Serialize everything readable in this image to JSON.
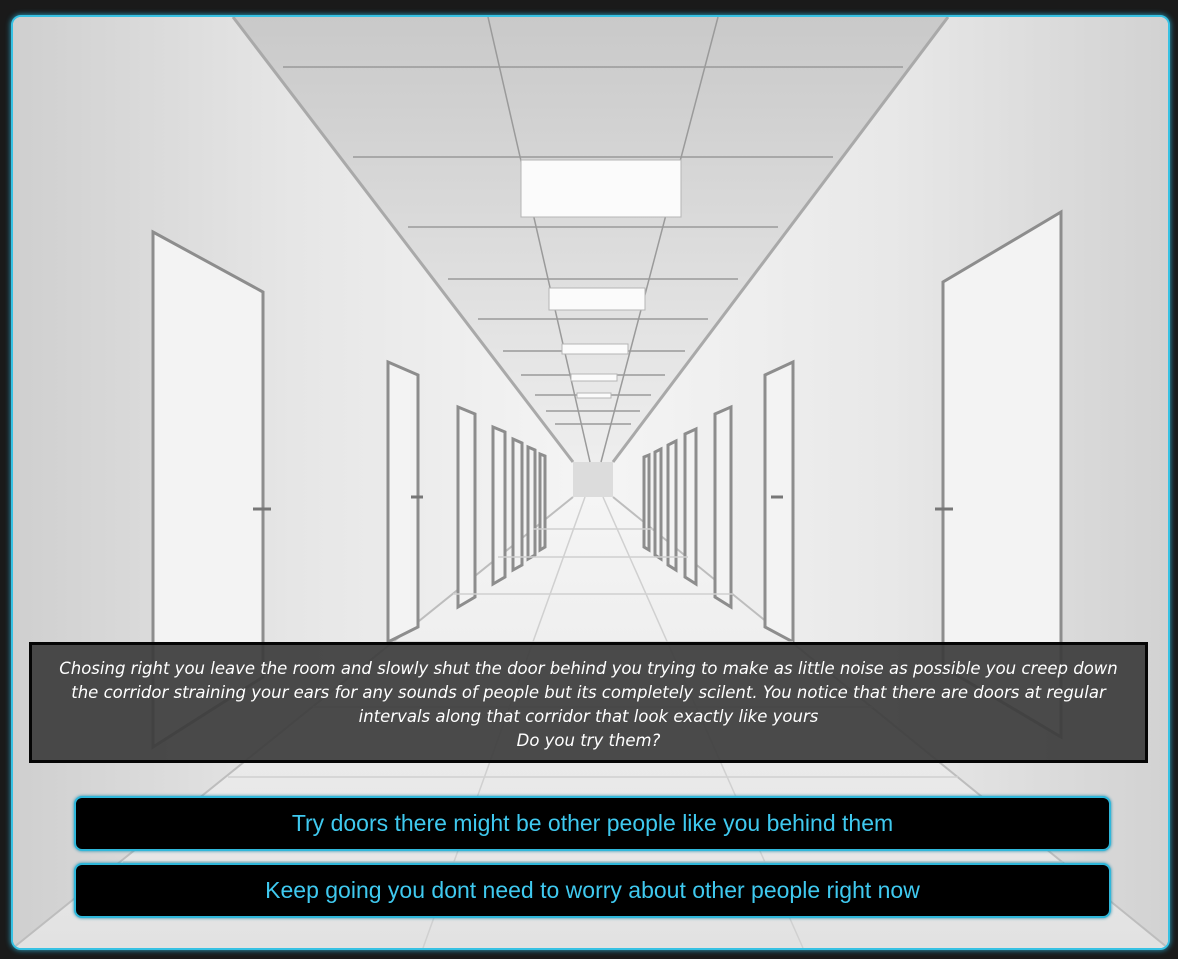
{
  "story": {
    "narration": "Chosing right you leave the room and slowly shut the door behind you trying to make as little noise as possible you creep down the corridor straining your ears for any sounds of people but its completely scilent. You notice that there are doors at regular intervals along that corridor that look exactly like yours",
    "question": "Do you try them?"
  },
  "choices": [
    {
      "label": "Try doors there might be other people like you behind them"
    },
    {
      "label": "Keep going you dont need to worry about other people right now"
    }
  ],
  "colors": {
    "accent": "#37c1e3",
    "choice_text": "#3fc9ef",
    "background": "#1a1a1a"
  }
}
